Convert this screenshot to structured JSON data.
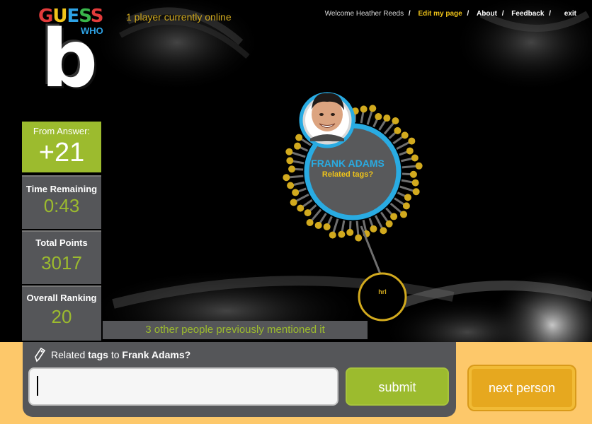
{
  "app": {
    "logo_main": "GUESS",
    "logo_sub": "WHO",
    "round_letter": "b",
    "players_online": "1 player currently online"
  },
  "nav": {
    "welcome": "Welcome Heather Reeds",
    "edit": "Edit my page",
    "about": "About",
    "feedback": "Feedback",
    "exit": "exit",
    "sep": "/"
  },
  "stats": {
    "answer_label": "From Answer:",
    "answer_value": "+21",
    "time_label": "Time Remaining",
    "time_value": "0:43",
    "points_label": "Total Points",
    "points_value": "3017",
    "rank_label": "Overall Ranking",
    "rank_value": "20"
  },
  "person": {
    "name": "FRANK ADAMS",
    "prompt": "Related tags?",
    "tag_node": "hrl"
  },
  "mentioned": "3 other people previously mentioned it",
  "form": {
    "prefix": "Related ",
    "tags_word": "tags",
    "to_word": " to ",
    "person_name": "Frank Adams?",
    "input_value": "",
    "submit_label": "submit",
    "next_label": "next person"
  },
  "colors": {
    "green": "#9cbb2e",
    "gold": "#d2aa1e",
    "blue": "#2ea3e6",
    "orange": "#fdc86a",
    "panel": "#555659"
  }
}
